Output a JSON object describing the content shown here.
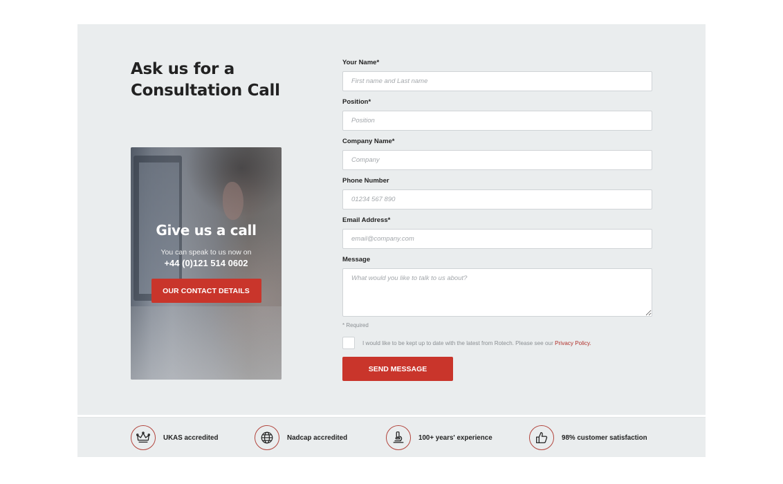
{
  "section": {
    "heading": "Ask us for a Consultation Call"
  },
  "call_card": {
    "title": "Give us a call",
    "subtitle": "You can speak to us now on",
    "phone": "+44 (0)121 514 0602",
    "button_label": "OUR CONTACT DETAILS"
  },
  "form": {
    "fields": [
      {
        "label": "Your Name*",
        "placeholder": "First name and Last name",
        "value": ""
      },
      {
        "label": "Position*",
        "placeholder": "Position",
        "value": ""
      },
      {
        "label": "Company Name*",
        "placeholder": "Company",
        "value": ""
      },
      {
        "label": "Phone Number",
        "placeholder": "01234 567 890",
        "value": ""
      },
      {
        "label": "Email Address*",
        "placeholder": "email@company.com",
        "value": ""
      },
      {
        "label": "Message",
        "placeholder": "What would you like to talk to us about?",
        "value": ""
      }
    ],
    "required_note": "* Required",
    "consent_text": "I would like to be kept up to date with the latest from Rotech. Please see our",
    "consent_link": "Privacy Policy.",
    "consent_checked": false,
    "submit_label": "SEND MESSAGE"
  },
  "badges": [
    {
      "icon": "crown-icon",
      "label": "UKAS accredited"
    },
    {
      "icon": "globe-icon",
      "label": "Nadcap accredited"
    },
    {
      "icon": "microscope-icon",
      "label": "100+ years' experience"
    },
    {
      "icon": "thumbs-up-icon",
      "label": "98% customer satisfaction"
    }
  ],
  "colors": {
    "accent": "#c9352b",
    "panel_bg": "#eaedee",
    "badge_ring": "#b2443c",
    "link": "#b12f29"
  }
}
